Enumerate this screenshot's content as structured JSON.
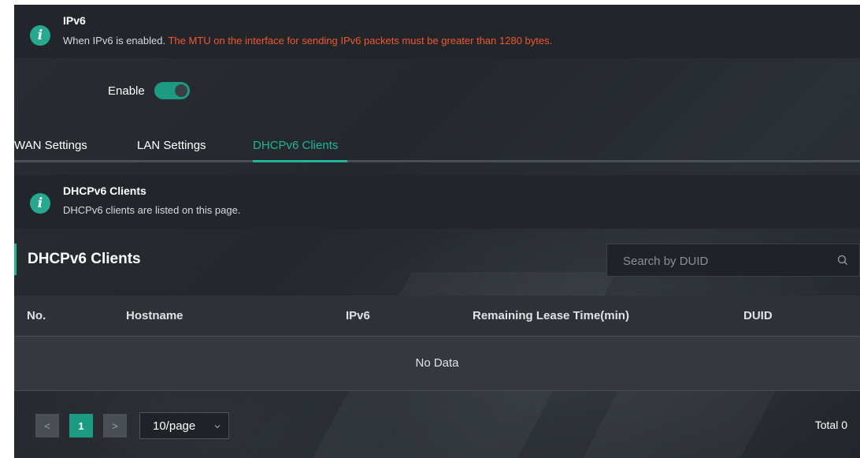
{
  "ipv6_alert": {
    "title": "IPv6",
    "desc_prefix": "When IPv6 is enabled.",
    "desc_warning": " The MTU on the interface for sending IPv6 packets must be greater than 1280 bytes.",
    "icon": "info-icon"
  },
  "enable": {
    "label": "Enable",
    "state": "on"
  },
  "tabs": [
    {
      "label": "WAN Settings",
      "active": false
    },
    {
      "label": "LAN Settings",
      "active": false
    },
    {
      "label": "DHCPv6 Clients",
      "active": true
    }
  ],
  "clients_alert": {
    "title": "DHCPv6 Clients",
    "desc": "DHCPv6 clients are listed on this page.",
    "icon": "info-icon"
  },
  "section": {
    "title": "DHCPv6 Clients"
  },
  "search": {
    "placeholder": "Search by DUID",
    "value": "",
    "icon": "search-icon"
  },
  "table": {
    "columns": [
      "No.",
      "Hostname",
      "IPv6",
      "Remaining Lease Time(min)",
      "DUID"
    ],
    "rows": [],
    "empty_text": "No Data"
  },
  "pagination": {
    "prev": "<",
    "current_page": "1",
    "next": ">",
    "page_size": "10/page",
    "total": "Total 0"
  },
  "colors": {
    "accent": "#1fb598",
    "warning": "#f0572f",
    "background": "#262a2f"
  }
}
